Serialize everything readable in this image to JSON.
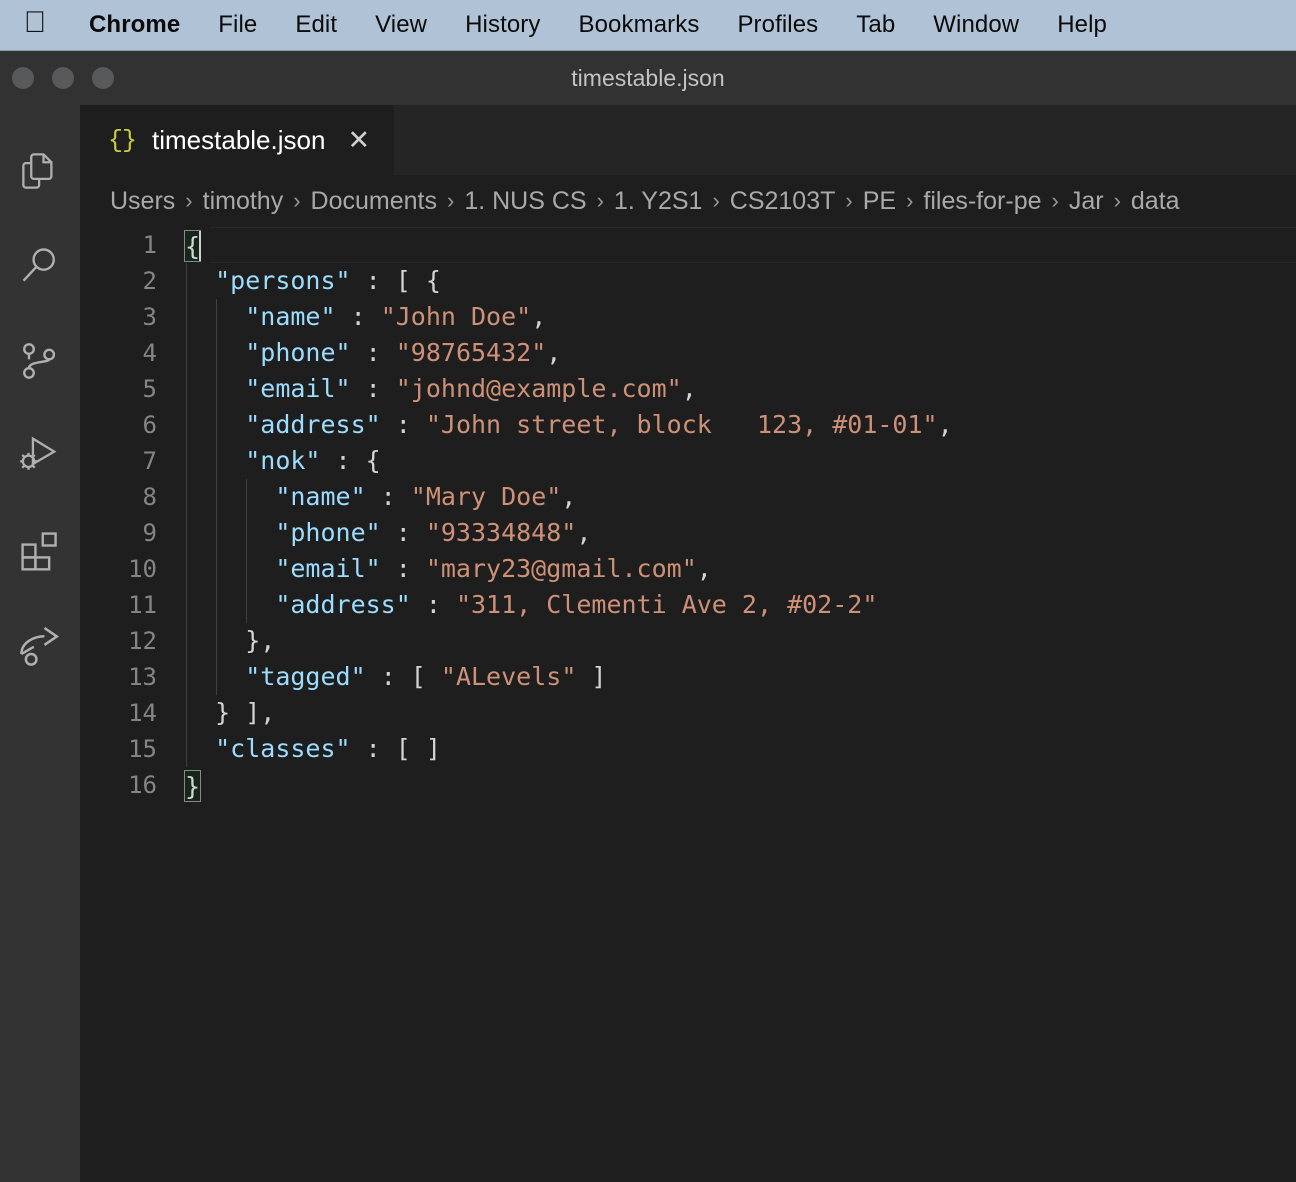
{
  "menubar": {
    "apple_logo": "",
    "items": [
      {
        "label": "Chrome",
        "bold": true
      },
      {
        "label": "File",
        "bold": false
      },
      {
        "label": "Edit",
        "bold": false
      },
      {
        "label": "View",
        "bold": false
      },
      {
        "label": "History",
        "bold": false
      },
      {
        "label": "Bookmarks",
        "bold": false
      },
      {
        "label": "Profiles",
        "bold": false
      },
      {
        "label": "Tab",
        "bold": false
      },
      {
        "label": "Window",
        "bold": false
      },
      {
        "label": "Help",
        "bold": false
      }
    ]
  },
  "window": {
    "title": "timestable.json",
    "traffic_lights": [
      "close-button",
      "minimize-button",
      "maximize-button"
    ]
  },
  "activitybar": {
    "items": [
      {
        "name": "explorer-icon",
        "label": "Explorer"
      },
      {
        "name": "search-icon",
        "label": "Search"
      },
      {
        "name": "source-control-icon",
        "label": "Source Control"
      },
      {
        "name": "run-and-debug-icon",
        "label": "Run and Debug"
      },
      {
        "name": "extensions-icon",
        "label": "Extensions"
      },
      {
        "name": "share-arrow-icon",
        "label": "Share"
      }
    ]
  },
  "tab": {
    "icon": "json-braces-icon",
    "icon_glyph": "{}",
    "label": "timestable.json",
    "close_glyph": "✕"
  },
  "breadcrumb": {
    "separator": "›",
    "crumbs": [
      "Users",
      "timothy",
      "Documents",
      "1. NUS CS",
      "1. Y2S1",
      "CS2103T",
      "PE",
      "files-for-pe",
      "Jar",
      "data"
    ]
  },
  "editor": {
    "filename": "timestable.json",
    "language": "json",
    "line_numbers": [
      "1",
      "2",
      "3",
      "4",
      "5",
      "6",
      "7",
      "8",
      "9",
      "10",
      "11",
      "12",
      "13",
      "14",
      "15",
      "16"
    ],
    "colors": {
      "background": "#1e1e1e",
      "key": "#9cdcfe",
      "string": "#ce9178",
      "punctuation": "#d4d4d4",
      "line_number": "#858585",
      "indent_guide": "#404040"
    },
    "lines": [
      {
        "n": "1",
        "text": "{"
      },
      {
        "n": "2",
        "text": "  \"persons\" : [ {"
      },
      {
        "n": "3",
        "text": "    \"name\" : \"John Doe\","
      },
      {
        "n": "4",
        "text": "    \"phone\" : \"98765432\","
      },
      {
        "n": "5",
        "text": "    \"email\" : \"johnd@example.com\","
      },
      {
        "n": "6",
        "text": "    \"address\" : \"John street, block   123, #01-01\","
      },
      {
        "n": "7",
        "text": "    \"nok\" : {"
      },
      {
        "n": "8",
        "text": "      \"name\" : \"Mary Doe\","
      },
      {
        "n": "9",
        "text": "      \"phone\" : \"93334848\","
      },
      {
        "n": "10",
        "text": "      \"email\" : \"mary23@gmail.com\","
      },
      {
        "n": "11",
        "text": "      \"address\" : \"311, Clementi Ave 2, #02-2\""
      },
      {
        "n": "12",
        "text": "    },"
      },
      {
        "n": "13",
        "text": "    \"tagged\" : [ \"ALevels\" ]"
      },
      {
        "n": "14",
        "text": "  } ],"
      },
      {
        "n": "15",
        "text": "  \"classes\" : [ ]"
      },
      {
        "n": "16",
        "text": "}"
      }
    ],
    "tokens": {
      "l1_brace": "{",
      "l2_key": "\"persons\"",
      "l2_rest": " : [ {",
      "l3_key": "\"name\"",
      "l3_colon": " : ",
      "l3_val": "\"John Doe\"",
      "l3_comma": ",",
      "l4_key": "\"phone\"",
      "l4_val": "\"98765432\"",
      "l5_key": "\"email\"",
      "l5_val": "\"johnd@example.com\"",
      "l6_key": "\"address\"",
      "l6_val": "\"John street, block   123, #01-01\"",
      "l7_key": "\"nok\"",
      "l7_rest": " : {",
      "l8_key": "\"name\"",
      "l8_val": "\"Mary Doe\"",
      "l9_key": "\"phone\"",
      "l9_val": "\"93334848\"",
      "l10_key": "\"email\"",
      "l10_val": "\"mary23@gmail.com\"",
      "l11_key": "\"address\"",
      "l11_val": "\"311, Clementi Ave 2, #02-2\"",
      "l12_text": "},",
      "l13_key": "\"tagged\"",
      "l13_open": " : [ ",
      "l13_val": "\"ALevels\"",
      "l13_close": " ]",
      "l14_text": "} ],",
      "l15_key": "\"classes\"",
      "l15_rest": " : [ ]",
      "l16_brace": "}"
    }
  }
}
